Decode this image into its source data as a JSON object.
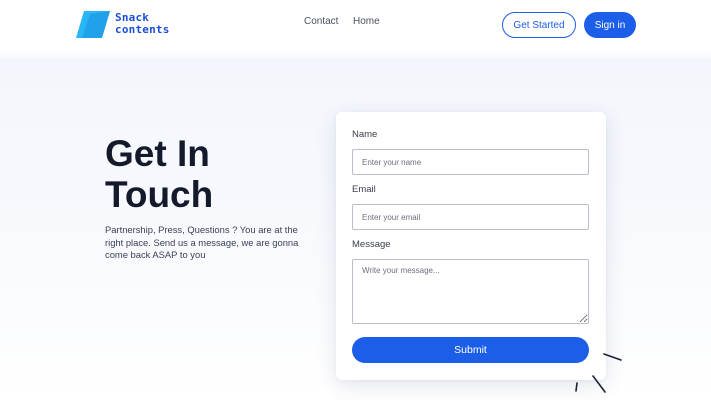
{
  "brand": {
    "name_line1": "Snack",
    "name_line2": "contents",
    "colors": {
      "primary": "#1d5ee8",
      "logo_light": "#29b6f6",
      "logo_dark": "#1a4fd6"
    },
    "logo_icon": "parallelogram-logo-icon"
  },
  "nav": {
    "contact": "Contact",
    "home": "Home"
  },
  "header_actions": {
    "get_started": "Get Started",
    "sign_in": "Sign in"
  },
  "hero": {
    "title_line1": "Get In",
    "title_line2": "Touch",
    "description": "Partnership, Press, Questions ? You are at the right place. Send us a message, we are gonna come back ASAP to you"
  },
  "form": {
    "name_label": "Name",
    "name_placeholder": "Enter your name",
    "name_value": "",
    "email_label": "Email",
    "email_placeholder": "Enter your email",
    "email_value": "",
    "message_label": "Message",
    "message_placeholder": "Write your message...",
    "message_value": "",
    "submit_label": "Submit"
  },
  "decoration": {
    "icon": "sparkle-lines-icon"
  }
}
